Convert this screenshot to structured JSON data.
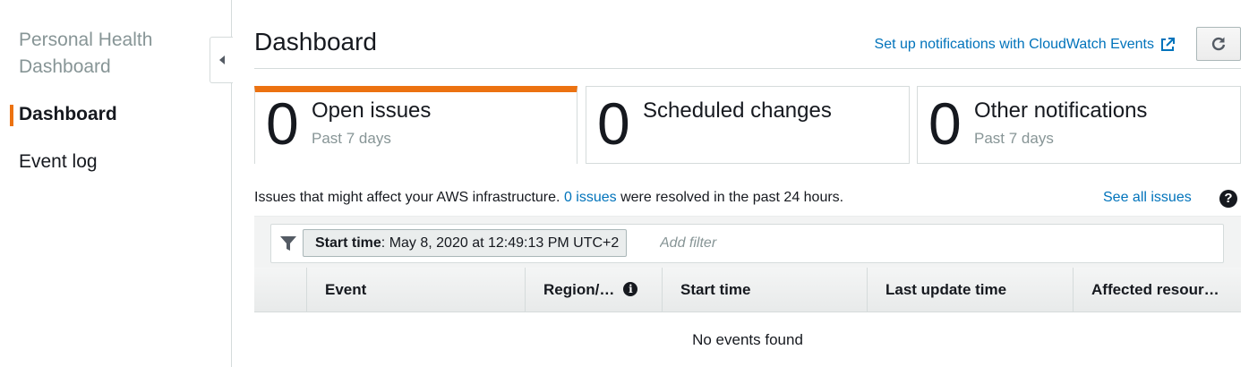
{
  "sidebar": {
    "title": "Personal Health Dashboard",
    "items": [
      {
        "label": "Dashboard",
        "active": true
      },
      {
        "label": "Event log",
        "active": false
      }
    ]
  },
  "header": {
    "title": "Dashboard",
    "notifications_link": "Set up notifications with CloudWatch Events",
    "refresh_icon": "refresh-icon",
    "external_icon": "external-link-icon"
  },
  "cards": [
    {
      "count": "0",
      "label": "Open issues",
      "sub": "Past 7 days",
      "active": true
    },
    {
      "count": "0",
      "label": "Scheduled changes",
      "sub": "",
      "active": false
    },
    {
      "count": "0",
      "label": "Other notifications",
      "sub": "Past 7 days",
      "active": false
    }
  ],
  "info": {
    "text_before": "Issues that might affect your AWS infrastructure.",
    "link": "0 issues",
    "text_after": "were resolved in the past 24 hours.",
    "see_all": "See all issues",
    "help_icon": "help-icon"
  },
  "filter": {
    "token_key": "Start time",
    "token_value": ": May 8, 2020 at 12:49:13 PM UTC+2",
    "placeholder": "Add filter",
    "icon": "funnel-icon"
  },
  "table": {
    "columns": [
      "Event",
      "Region/…",
      "Start time",
      "Last update time",
      "Affected resour…"
    ],
    "empty_message": "No events found"
  },
  "colors": {
    "accent": "#ec7211",
    "link": "#0073bb",
    "text": "#16191f",
    "muted": "#879596"
  }
}
